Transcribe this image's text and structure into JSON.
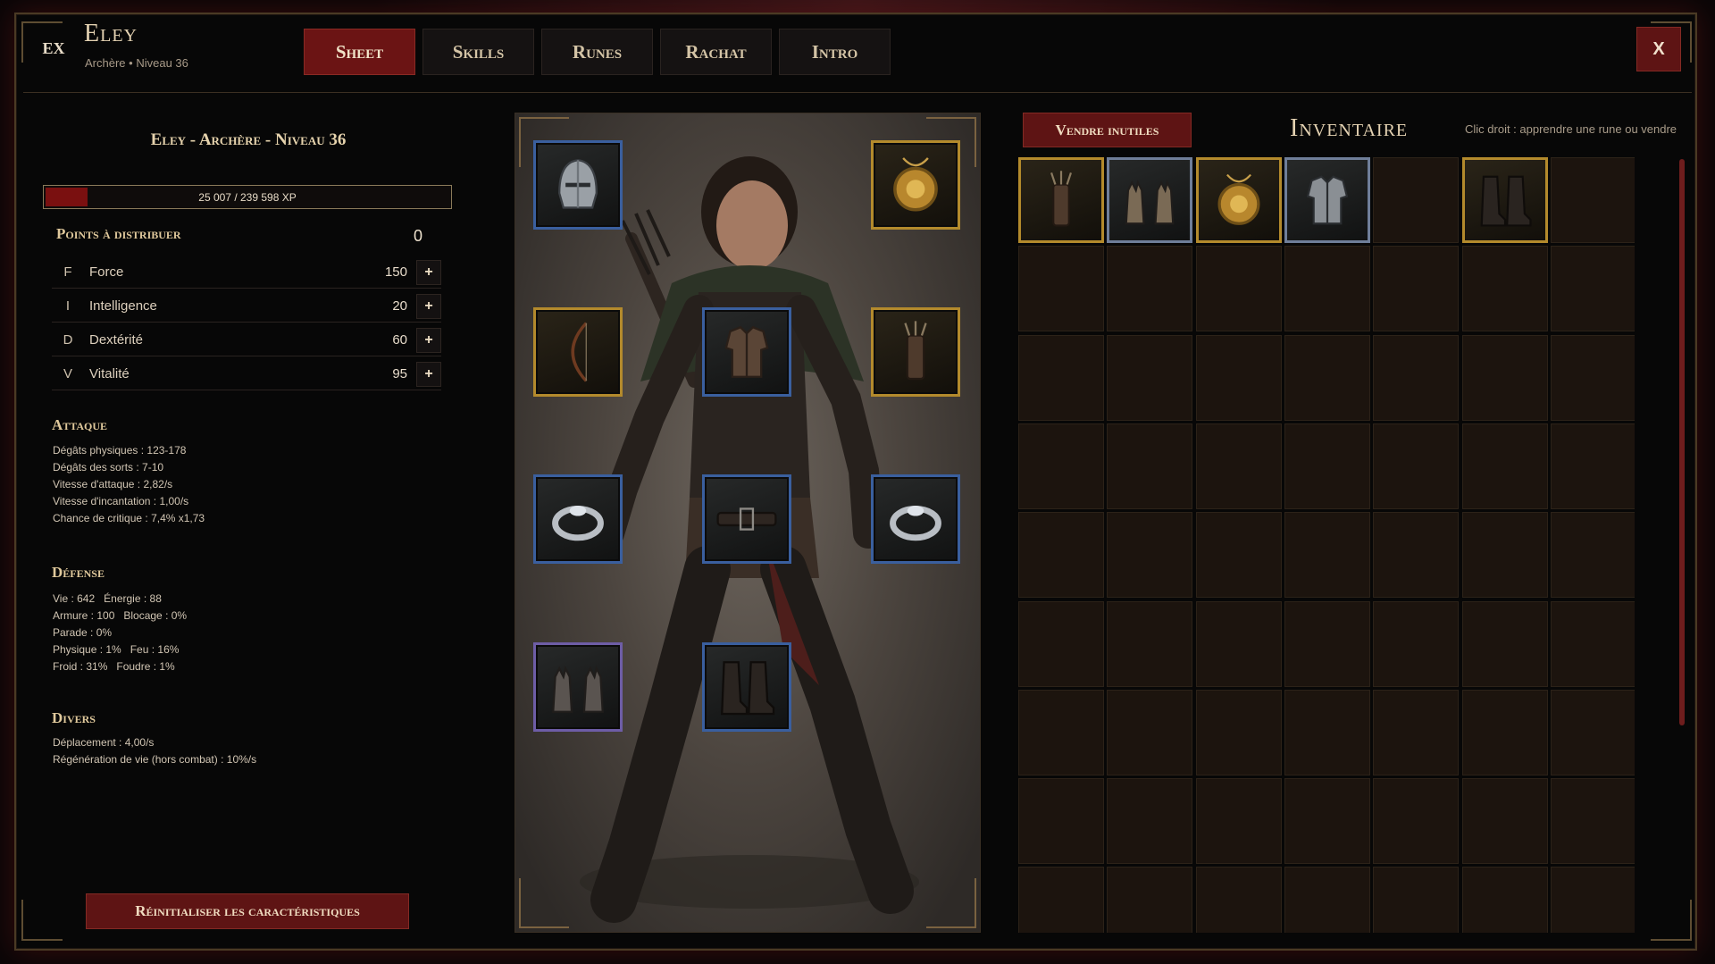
{
  "header": {
    "badge": "EX",
    "hero_name": "Eley",
    "hero_class": "Archère",
    "hero_level": "Niveau 36",
    "tabs": [
      {
        "label": "Sheet",
        "active": true
      },
      {
        "label": "Skills",
        "active": false
      },
      {
        "label": "Runes",
        "active": false
      },
      {
        "label": "Rachat",
        "active": false
      },
      {
        "label": "Intro",
        "active": false
      }
    ],
    "close_label": "X"
  },
  "sheet": {
    "title": "Eley - Archère - Niveau 36",
    "xp_text": "25 007 / 239 598 XP",
    "xp_fraction": 0.104,
    "points_label": "Points à distribuer",
    "points_value": "0",
    "stats": [
      {
        "abbr": "F",
        "name": "Force",
        "value": "150"
      },
      {
        "abbr": "I",
        "name": "Intelligence",
        "value": "20"
      },
      {
        "abbr": "D",
        "name": "Dextérité",
        "value": "60"
      },
      {
        "abbr": "V",
        "name": "Vitalité",
        "value": "95"
      }
    ],
    "plus_label": "+",
    "attack": {
      "title": "Attaque",
      "lines": [
        "Dégâts physiques : 123-178",
        "Dégâts des sorts : 7-10",
        "Vitesse d'attaque : 2,82/s",
        "Vitesse d'incantation : 1,00/s",
        "Chance de critique : 7,4% x1,73"
      ]
    },
    "defense": {
      "title": "Défense",
      "lines": [
        "Vie : 642   Énergie : 88",
        "Armure : 100   Blocage : 0%",
        "Parade : 0%",
        "Physique : 1%   Feu : 16%",
        "Froid : 31%   Foudre : 1%"
      ]
    },
    "misc": {
      "title": "Divers",
      "lines": [
        "Déplacement : 4,00/s",
        "Régénération de vie (hors combat) : 10%/s"
      ]
    },
    "reset_label": "Réinitialiser les caractéristiques"
  },
  "equipment": {
    "slots": [
      {
        "slot": "helmet",
        "icon": "helmet-icon",
        "rarity": "magic"
      },
      {
        "slot": "amulet",
        "icon": "amulet-icon",
        "rarity": "gold"
      },
      {
        "slot": "weapon",
        "icon": "bow-icon",
        "rarity": "gold"
      },
      {
        "slot": "chest",
        "icon": "armor-icon",
        "rarity": "magic"
      },
      {
        "slot": "offhand",
        "icon": "quiver-icon",
        "rarity": "gold"
      },
      {
        "slot": "ring-left",
        "icon": "ring-icon",
        "rarity": "magic"
      },
      {
        "slot": "belt",
        "icon": "belt-icon",
        "rarity": "magic"
      },
      {
        "slot": "ring-right",
        "icon": "ring-icon",
        "rarity": "magic"
      },
      {
        "slot": "gloves",
        "icon": "gloves-icon",
        "rarity": "rare"
      },
      {
        "slot": "boots",
        "icon": "boots-icon",
        "rarity": "magic"
      }
    ]
  },
  "inventory": {
    "sell_label": "Vendre inutiles",
    "title": "Inventaire",
    "hint": "Clic droit : apprendre une rune ou vendre",
    "columns": 7,
    "rows": 9,
    "items": [
      {
        "col": 0,
        "row": 0,
        "icon": "quiver-icon",
        "rarity": "gold"
      },
      {
        "col": 1,
        "row": 0,
        "icon": "gloves-icon",
        "rarity": "magic"
      },
      {
        "col": 2,
        "row": 0,
        "icon": "amulet-icon",
        "rarity": "gold"
      },
      {
        "col": 3,
        "row": 0,
        "icon": "armor-icon",
        "rarity": "magic"
      },
      {
        "col": 5,
        "row": 0,
        "icon": "boots-icon",
        "rarity": "gold"
      }
    ]
  },
  "colors": {
    "accent_red": "#6b1414",
    "gold_border": "#b38a2c",
    "magic_border": "#3a5f9e",
    "rare_border": "#6e5da6"
  }
}
